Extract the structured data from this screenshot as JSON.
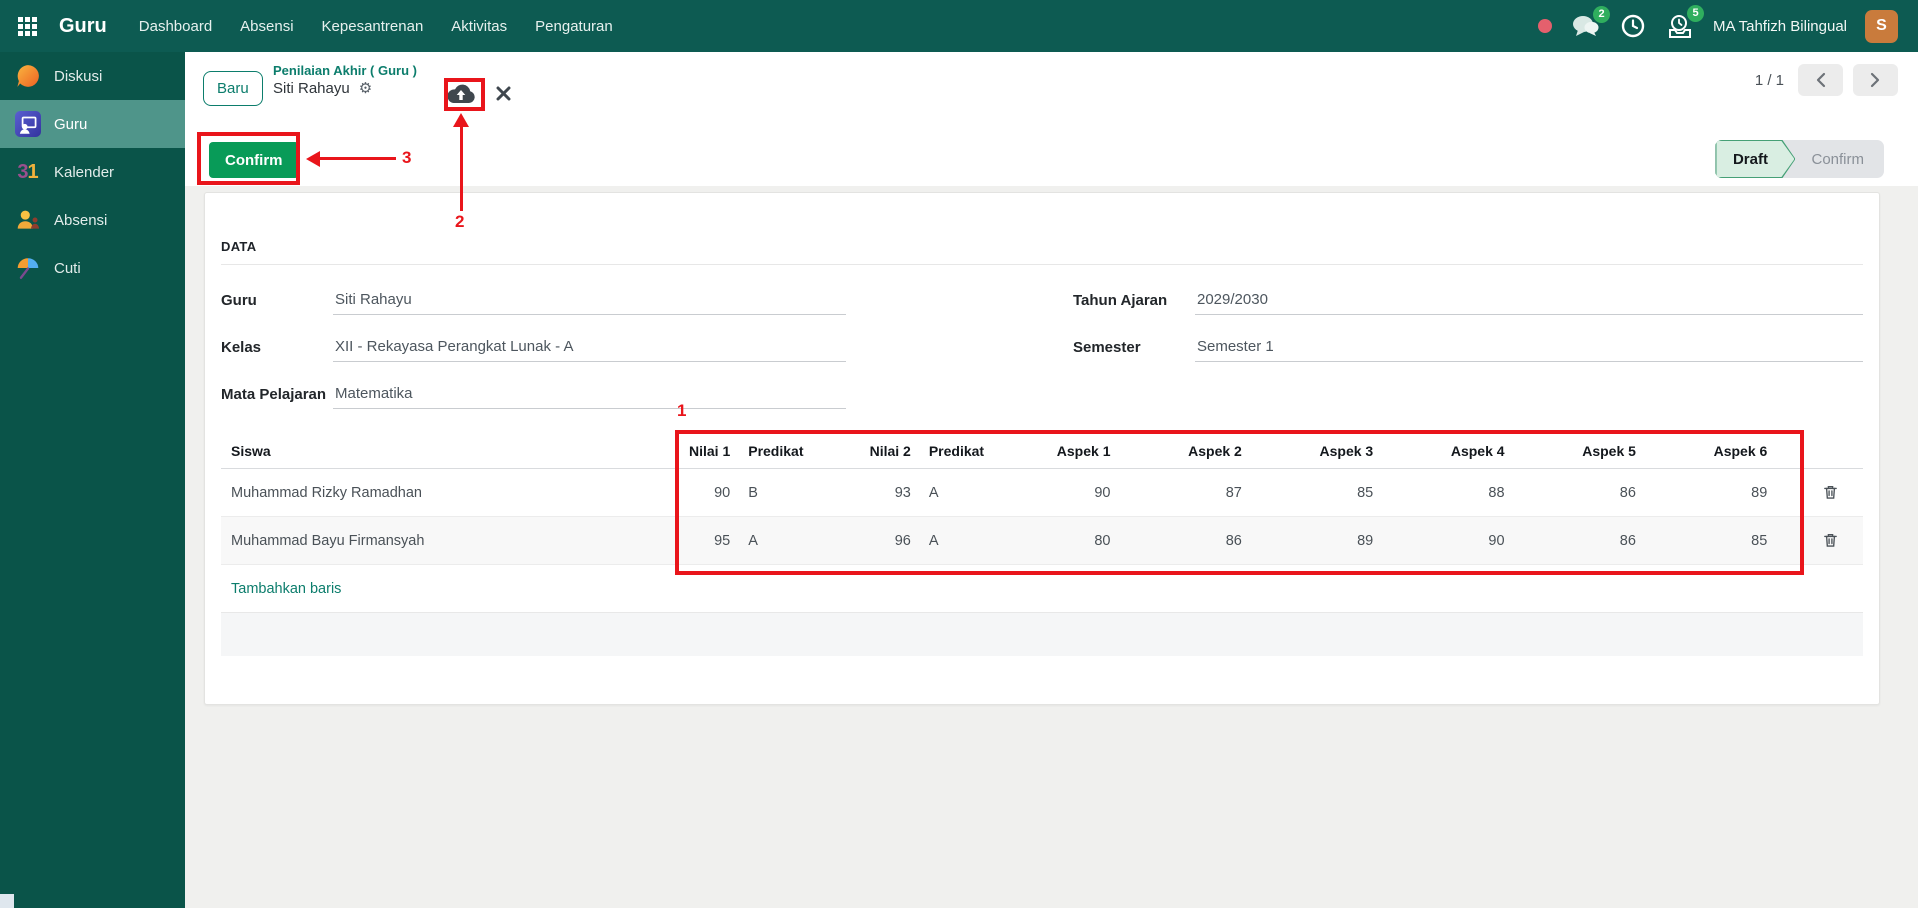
{
  "navbar": {
    "brand": "Guru",
    "menu": [
      "Dashboard",
      "Absensi",
      "Kepesantrenan",
      "Aktivitas",
      "Pengaturan"
    ],
    "badges": {
      "messages": "2",
      "activities": "5"
    },
    "company": "MA Tahfizh Bilingual",
    "avatar_initial": "S"
  },
  "sidebar": {
    "items": [
      {
        "label": "Diskusi"
      },
      {
        "label": "Guru"
      },
      {
        "label": "Kalender",
        "icon_text_a": "3",
        "icon_text_b": "1"
      },
      {
        "label": "Absensi"
      },
      {
        "label": "Cuti"
      }
    ]
  },
  "breadcrumb": {
    "new_badge": "Baru",
    "parent": "Penilaian Akhir ( Guru )",
    "record": "Siti Rahayu",
    "pager": "1 / 1"
  },
  "actions": {
    "confirm": "Confirm"
  },
  "statusbar": {
    "steps": [
      {
        "label": "Draft",
        "active": true
      },
      {
        "label": "Confirm",
        "active": false
      }
    ]
  },
  "form": {
    "section": "DATA",
    "fields_left": [
      {
        "label": "Guru",
        "value": "Siti Rahayu"
      },
      {
        "label": "Kelas",
        "value": "XII - Rekayasa Perangkat Lunak - A"
      },
      {
        "label": "Mata Pelajaran",
        "value": "Matematika"
      }
    ],
    "fields_right": [
      {
        "label": "Tahun Ajaran",
        "value": "2029/2030"
      },
      {
        "label": "Semester",
        "value": "Semester 1"
      }
    ]
  },
  "table": {
    "headers": [
      "Siswa",
      "Nilai 1",
      "Predikat",
      "Nilai 2",
      "Predikat",
      "Aspek 1",
      "Aspek 2",
      "Aspek 3",
      "Aspek 4",
      "Aspek 5",
      "Aspek 6"
    ],
    "rows": [
      {
        "siswa": "Muhammad Rizky Ramadhan",
        "nilai1": "90",
        "predikat1": "B",
        "nilai2": "93",
        "predikat2": "A",
        "aspek": [
          "90",
          "87",
          "85",
          "88",
          "86",
          "89"
        ]
      },
      {
        "siswa": "Muhammad Bayu Firmansyah",
        "nilai1": "95",
        "predikat1": "A",
        "nilai2": "96",
        "predikat2": "A",
        "aspek": [
          "80",
          "86",
          "89",
          "90",
          "86",
          "85"
        ]
      }
    ],
    "add_row": "Tambahkan baris"
  },
  "annotations": {
    "labels": [
      "1",
      "2",
      "3"
    ],
    "color": "#e9151b"
  },
  "colors": {
    "navbar_bg": "#0d5b52",
    "sidebar_bg": "#0a5449",
    "sidebar_active_bg": "#4f958a",
    "accent_teal": "#0c7d6c",
    "confirm_green": "#089b58",
    "badge_green": "#2fae5e",
    "avatar_orange": "#c97b3c",
    "annotation_red": "#e9151b"
  }
}
